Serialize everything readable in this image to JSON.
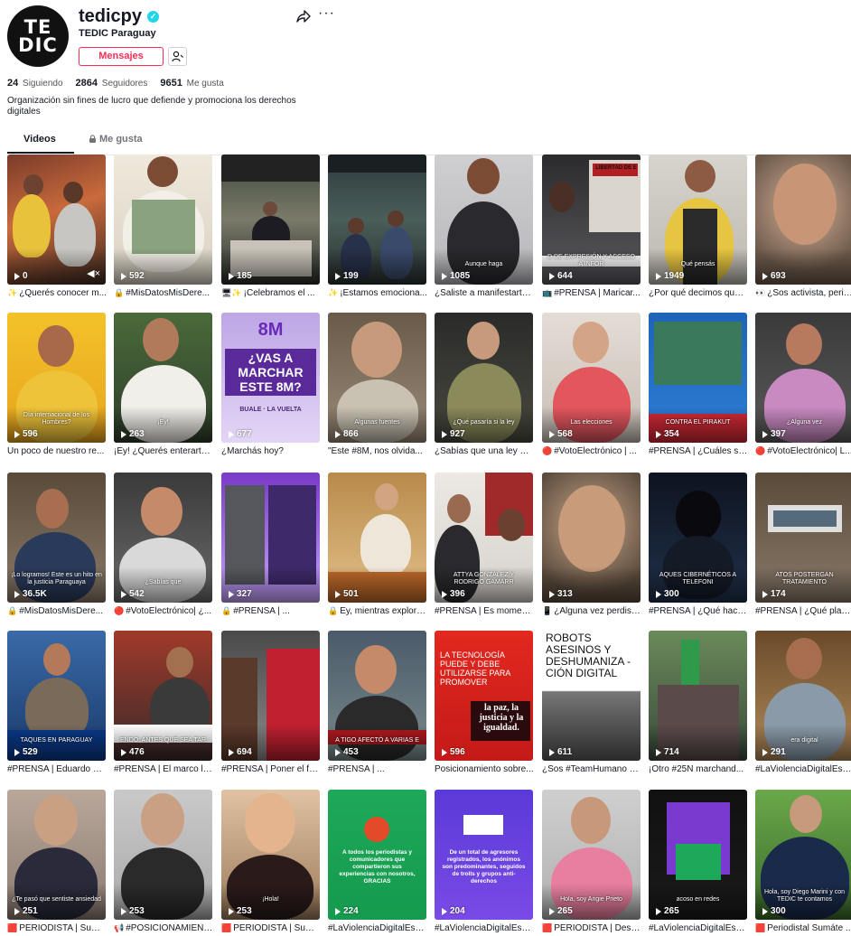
{
  "profile": {
    "avatar_text": "TE DIC",
    "username": "tedicpy",
    "nickname": "TEDIC Paraguay",
    "message_button": "Mensajes",
    "stats": {
      "following": "24",
      "following_label": "Siguiendo",
      "followers": "2864",
      "followers_label": "Seguidores",
      "likes": "9651",
      "likes_label": "Me gusta"
    },
    "bio": "Organización sin fines de lucro que defiende y promociona los derechos digitales"
  },
  "tabs": {
    "videos": "Videos",
    "likes": "Me gusta"
  },
  "videos": [
    {
      "views": "0",
      "caption": "¿Querés conocer m...",
      "emoji": "✨",
      "overlay": ""
    },
    {
      "views": "592",
      "caption": "#MisDatosMisDere...",
      "emoji": "🔒",
      "overlay": ""
    },
    {
      "views": "185",
      "caption": "¡Celebramos el ...",
      "emoji": "🖥✨",
      "overlay": ""
    },
    {
      "views": "199",
      "caption": "¡Estamos emociona...",
      "emoji": "✨",
      "overlay": ""
    },
    {
      "views": "1085",
      "caption": "¿Saliste a manifestarte...",
      "emoji": "",
      "overlay": "Aunque haga"
    },
    {
      "views": "644",
      "caption": "#PRENSA | Maricar...",
      "emoji": "📺",
      "overlay": "D DE EXPRESIÓN Y ACCESO A INFOR",
      "overlay_top": "LIBERTAD DE E"
    },
    {
      "views": "1949",
      "caption": "¿Por qué decimos que ...",
      "emoji": "",
      "overlay": "Qué pensás"
    },
    {
      "views": "693",
      "caption": "¿Sos activista, perio...",
      "emoji": "👀",
      "overlay": ""
    },
    {
      "views": "596",
      "caption": "Un poco de nuestro re...",
      "emoji": "",
      "overlay": "Día internacional de los Hombres?"
    },
    {
      "views": "263",
      "caption": "¡Ey! ¿Querés enterarte ...",
      "emoji": "",
      "overlay": "¡Ey!"
    },
    {
      "views": "677",
      "caption": "¿Marchás hoy?",
      "emoji": "",
      "overlay": "¿VAS A MARCHAR ESTE 8M?",
      "overlay_top": "8M",
      "overlay_bottom": "BUALE · LA VUELTA"
    },
    {
      "views": "866",
      "caption": "\"Este #8M, nos olvida...",
      "emoji": "",
      "overlay": "Algunas fuentes"
    },
    {
      "views": "927",
      "caption": "¿Sabías que una ley pa...",
      "emoji": "",
      "overlay": "¿Qué pasaría si la ley"
    },
    {
      "views": "568",
      "caption": "#VotoElectrónico | ...",
      "emoji": "🔴",
      "overlay": "Las elecciones"
    },
    {
      "views": "354",
      "caption": "#PRENSA | ¿Cuáles so...",
      "emoji": "",
      "overlay": "CONTRA EL PIRAKUT"
    },
    {
      "views": "397",
      "caption": "#VotoElectrónico| L...",
      "emoji": "🔴",
      "overlay": "¿Alguna vez"
    },
    {
      "views": "36.5K",
      "caption": "#MisDatosMisDere...",
      "emoji": "🔒",
      "overlay": "¡Lo logramos! Este es un hito en la justicia Paraguaya"
    },
    {
      "views": "542",
      "caption": "#VotoElectrónico| ¿...",
      "emoji": "🔴",
      "overlay": "¿Sabías que"
    },
    {
      "views": "327",
      "caption": "#PRENSA | ...",
      "emoji": "🔒",
      "overlay": ""
    },
    {
      "views": "501",
      "caption": "Ey, mientras explora...",
      "emoji": "🔒",
      "overlay": ""
    },
    {
      "views": "396",
      "caption": "#PRENSA | Es moment...",
      "emoji": "",
      "overlay": "ATTYA GONZÁLEZ Y RODRIGO GAMARR"
    },
    {
      "views": "313",
      "caption": "¿Alguna vez perdiste...",
      "emoji": "📱",
      "overlay": ""
    },
    {
      "views": "300",
      "caption": "#PRENSA | ¿Qué hace...",
      "emoji": "",
      "overlay": "AQUES CIBERNÉTICOS A TELEFONI"
    },
    {
      "views": "174",
      "caption": "#PRENSA | ¿Qué plant...",
      "emoji": "",
      "overlay": "ATOS POSTERGAN TRATAMIENTO"
    },
    {
      "views": "529",
      "caption": "#PRENSA | Eduardo Ca...",
      "emoji": "",
      "overlay": "TAQUES EN PARAGUAY"
    },
    {
      "views": "476",
      "caption": "#PRENSA | El marco le...",
      "emoji": "",
      "overlay": "ENDO: ANTES QUE SEA TAR"
    },
    {
      "views": "694",
      "caption": "#PRENSA | Poner el fo...",
      "emoji": "",
      "overlay": ""
    },
    {
      "views": "453",
      "caption": "#PRENSA | ...",
      "emoji": "",
      "overlay": "A TIGO AFECTÓ A VARIAS E"
    },
    {
      "views": "596",
      "caption": "Posicionamiento sobre...",
      "emoji": "",
      "overlay": "LA TECNOLOGÍA PUEDE Y DEBE UTILIZARSE PARA PROMOVER",
      "overlay_bottom": "la paz, la justicia y la igualdad."
    },
    {
      "views": "611",
      "caption": "¿Sos #TeamHumano o ...",
      "emoji": "",
      "overlay": "ROBOTS ASESINOS Y DESHUMANIZA - CIÓN DIGITAL"
    },
    {
      "views": "714",
      "caption": "¡Otro #25N marchand...",
      "emoji": "",
      "overlay": ""
    },
    {
      "views": "291",
      "caption": "#LaViolenciaDigitalEsR...",
      "emoji": "",
      "overlay": "era digital"
    },
    {
      "views": "251",
      "caption": "PERIODISTA | Sumá...",
      "emoji": "🟥",
      "overlay": "¿Te pasó que sentiste ansiedad"
    },
    {
      "views": "253",
      "caption": "#POSICIONAMIENT...",
      "emoji": "📢",
      "overlay": ""
    },
    {
      "views": "253",
      "caption": "PERIODISTA | Sumá...",
      "emoji": "🟥",
      "overlay": "¡Hola!"
    },
    {
      "views": "224",
      "caption": "#LaViolenciaDigitalEsR...",
      "emoji": "",
      "overlay": "A todos los periodistas y comunicadores que compartieron sus experiencias con nosotros, GRACIAS"
    },
    {
      "views": "204",
      "caption": "#LaViolenciaDigitalEsR...",
      "emoji": "",
      "overlay": "De un total de agresores registrados, los anónimos son predominantes, seguidos de trolls y grupos anti-derechos"
    },
    {
      "views": "265",
      "caption": "PERIODISTA | Desc...",
      "emoji": "🟥",
      "overlay": "Hola, soy Angie Prieto"
    },
    {
      "views": "265",
      "caption": "#LaViolenciaDigitalEsR...",
      "emoji": "",
      "overlay": "acoso en redes"
    },
    {
      "views": "300",
      "caption": "Periodistal Sumáte ...",
      "emoji": "🟥",
      "overlay": "Hola, soy Diego Marini y con TEDIC te contamos"
    }
  ],
  "colors": {
    "accent": "#fe2c55",
    "verified": "#20d5ec",
    "text": "#161823"
  }
}
